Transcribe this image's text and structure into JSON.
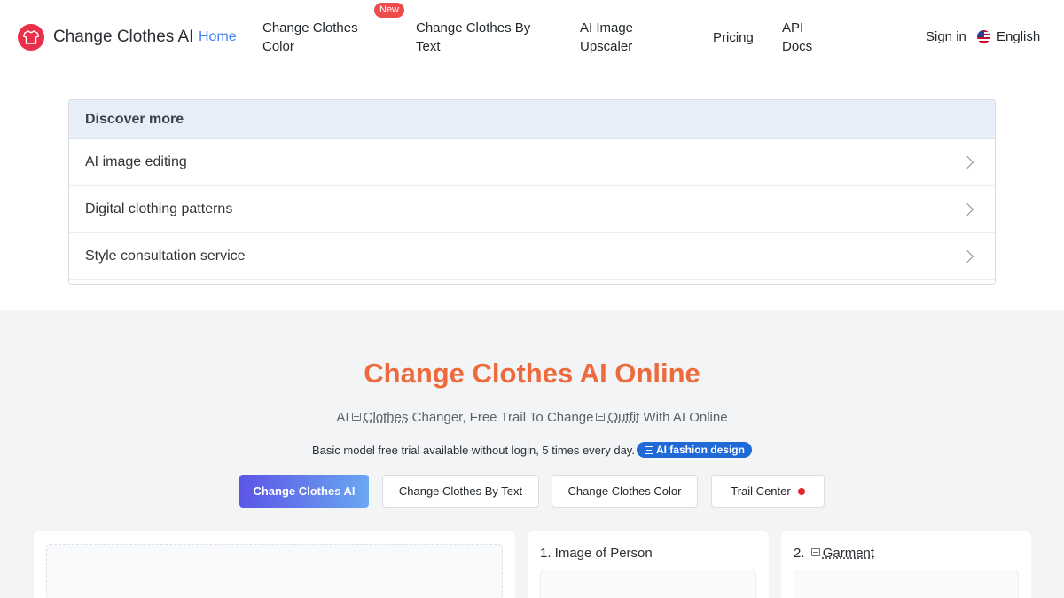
{
  "header": {
    "brand": "Change Clothes AI",
    "home": "Home",
    "nav": [
      {
        "line1": "Change Clothes",
        "line2": "Color"
      },
      {
        "line1": "Change Clothes By",
        "line2": "Text"
      },
      {
        "line1": "AI Image",
        "line2": "Upscaler"
      },
      {
        "line1": "Pricing",
        "line2": ""
      },
      {
        "line1": "API",
        "line2": "Docs"
      }
    ],
    "new_badge": "New",
    "signin": "Sign in",
    "language": "English"
  },
  "discover": {
    "title": "Discover more",
    "items": [
      "AI image editing",
      "Digital clothing patterns",
      "Style consultation service"
    ]
  },
  "hero": {
    "title": "Change Clothes AI Online",
    "sub_part1": "AI",
    "sub_link1": "Clothes",
    "sub_part2": "Changer, Free Trail To Change",
    "sub_link2": "Outfit",
    "sub_part3": "With AI Online",
    "note": "Basic model free trial available without login, 5 times every day.",
    "pill": "AI fashion design"
  },
  "tabs": [
    "Change Clothes AI",
    "Change Clothes By Text",
    "Change Clothes Color",
    "Trail Center"
  ],
  "cards": {
    "person_label": "1. Image of Person",
    "garment_prefix": "2.",
    "garment_label": "Garment"
  },
  "colors": {
    "accent": "#3b82f6",
    "title_orange": "#ec6a3c",
    "brand_red": "#e8304a",
    "pill_blue": "#1f6ad6"
  }
}
